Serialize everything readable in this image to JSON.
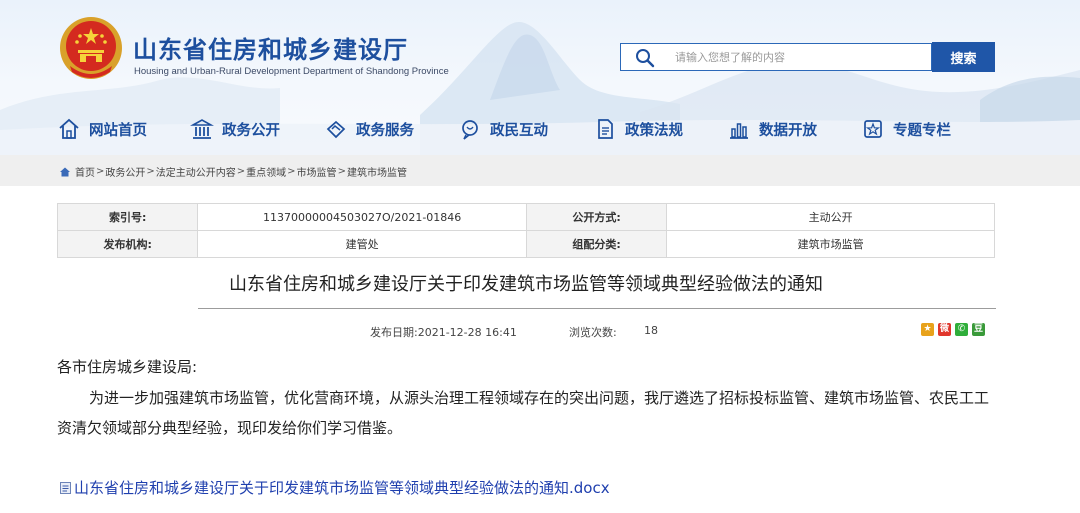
{
  "header": {
    "site_title": "山东省住房和城乡建设厅",
    "site_subtitle": "Housing and Urban-Rural Development Department of Shandong Province",
    "search_placeholder": "请输入您想了解的内容",
    "search_button": "搜索"
  },
  "nav": {
    "items": [
      {
        "label": "网站首页",
        "icon": "home-icon"
      },
      {
        "label": "政务公开",
        "icon": "government-building-icon"
      },
      {
        "label": "政务服务",
        "icon": "handshake-icon"
      },
      {
        "label": "政民互动",
        "icon": "chat-icon"
      },
      {
        "label": "政策法规",
        "icon": "document-icon"
      },
      {
        "label": "数据开放",
        "icon": "bar-chart-icon"
      },
      {
        "label": "专题专栏",
        "icon": "star-board-icon"
      }
    ]
  },
  "breadcrumb": {
    "items": [
      "首页",
      "政务公开",
      "法定主动公开内容",
      "重点领域",
      "市场监管",
      "建筑市场监管"
    ],
    "separator": ">"
  },
  "info_table": {
    "index_label": "索引号:",
    "index_value": "11370000004503027O/2021-01846",
    "disclosure_label": "公开方式:",
    "disclosure_value": "主动公开",
    "publisher_label": "发布机构:",
    "publisher_value": "建管处",
    "category_label": "组配分类:",
    "category_value": "建筑市场监管"
  },
  "article": {
    "title": "山东省住房和城乡建设厅关于印发建筑市场监管等领域典型经验做法的通知",
    "publish_date": "发布日期:2021-12-28 16:41",
    "views_label": "浏览次数:",
    "views_count": "18",
    "salutation": "各市住房城乡建设局:",
    "body": "为进一步加强建筑市场监管，优化营商环境，从源头治理工程领域存在的突出问题，我厅遴选了招标投标监管、建筑市场监管、农民工工资清欠领域部分典型经验，现印发给你们学习借鉴。",
    "attachment": "山东省住房和城乡建设厅关于印发建筑市场监管等领域典型经验做法的通知.docx"
  },
  "share": {
    "icons": [
      {
        "name": "qzone-share-icon",
        "glyph": "★",
        "color": "#e8a21b"
      },
      {
        "name": "weibo-share-icon",
        "glyph": "微",
        "color": "#e0362c"
      },
      {
        "name": "wechat-share-icon",
        "glyph": "✆",
        "color": "#2fae3a"
      },
      {
        "name": "douban-share-icon",
        "glyph": "豆",
        "color": "#3a9a3a"
      }
    ]
  },
  "colors": {
    "brand_blue": "#1d4f9e",
    "search_button": "#1f56a8",
    "link": "#1f3fae"
  }
}
